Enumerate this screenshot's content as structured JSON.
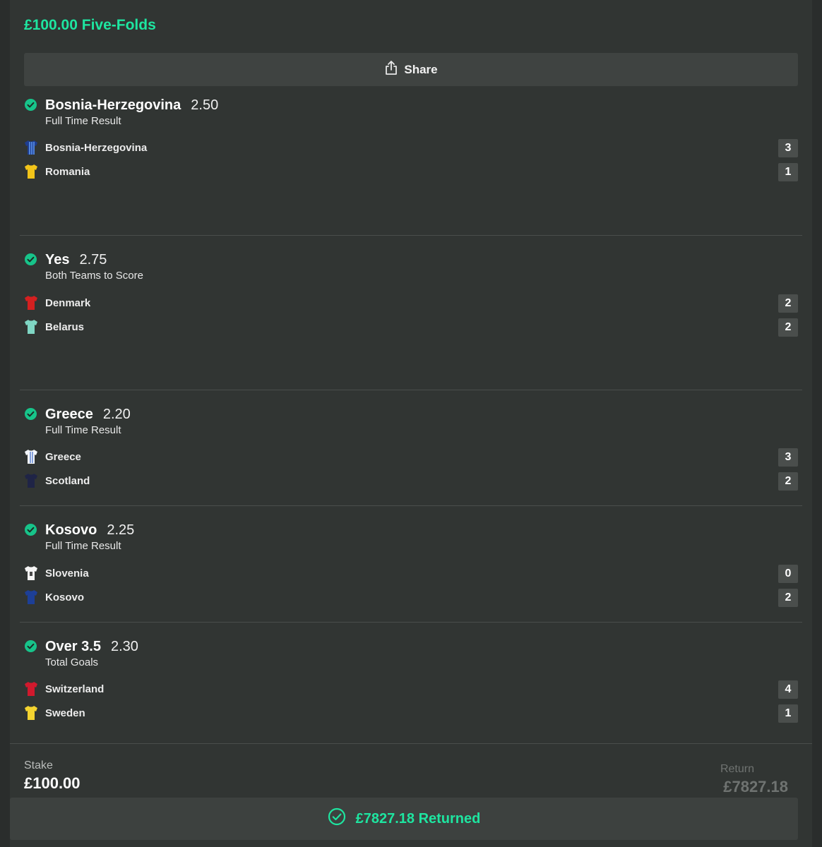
{
  "bet_title": "£100.00 Five-Folds",
  "share_label": "Share",
  "selections": [
    {
      "name": "Bosnia-Herzegovina",
      "odds": "2.50",
      "market": "Full Time Result",
      "teams": [
        {
          "name": "Bosnia-Herzegovina",
          "score": "3",
          "kit": "bosnia-kit-icon"
        },
        {
          "name": "Romania",
          "score": "1",
          "kit": "romania-kit-icon"
        }
      ]
    },
    {
      "name": "Yes",
      "odds": "2.75",
      "market": "Both Teams to Score",
      "teams": [
        {
          "name": "Denmark",
          "score": "2",
          "kit": "denmark-kit-icon"
        },
        {
          "name": "Belarus",
          "score": "2",
          "kit": "belarus-kit-icon"
        }
      ]
    },
    {
      "name": "Greece",
      "odds": "2.20",
      "market": "Full Time Result",
      "teams": [
        {
          "name": "Greece",
          "score": "3",
          "kit": "greece-kit-icon"
        },
        {
          "name": "Scotland",
          "score": "2",
          "kit": "scotland-kit-icon"
        }
      ]
    },
    {
      "name": "Kosovo",
      "odds": "2.25",
      "market": "Full Time Result",
      "teams": [
        {
          "name": "Slovenia",
          "score": "0",
          "kit": "slovenia-kit-icon"
        },
        {
          "name": "Kosovo",
          "score": "2",
          "kit": "kosovo-kit-icon"
        }
      ]
    },
    {
      "name": "Over 3.5",
      "odds": "2.30",
      "market": "Total Goals",
      "teams": [
        {
          "name": "Switzerland",
          "score": "4",
          "kit": "switzerland-kit-icon"
        },
        {
          "name": "Sweden",
          "score": "1",
          "kit": "sweden-kit-icon"
        }
      ]
    }
  ],
  "stake": {
    "label": "Stake",
    "value": "£100.00"
  },
  "return": {
    "label": "Return",
    "value": "£7827.18"
  },
  "returned_label": "£7827.18 Returned",
  "colors": {
    "accent": "#1ee5a0",
    "check": "#17c48a",
    "panel": "#313533"
  }
}
